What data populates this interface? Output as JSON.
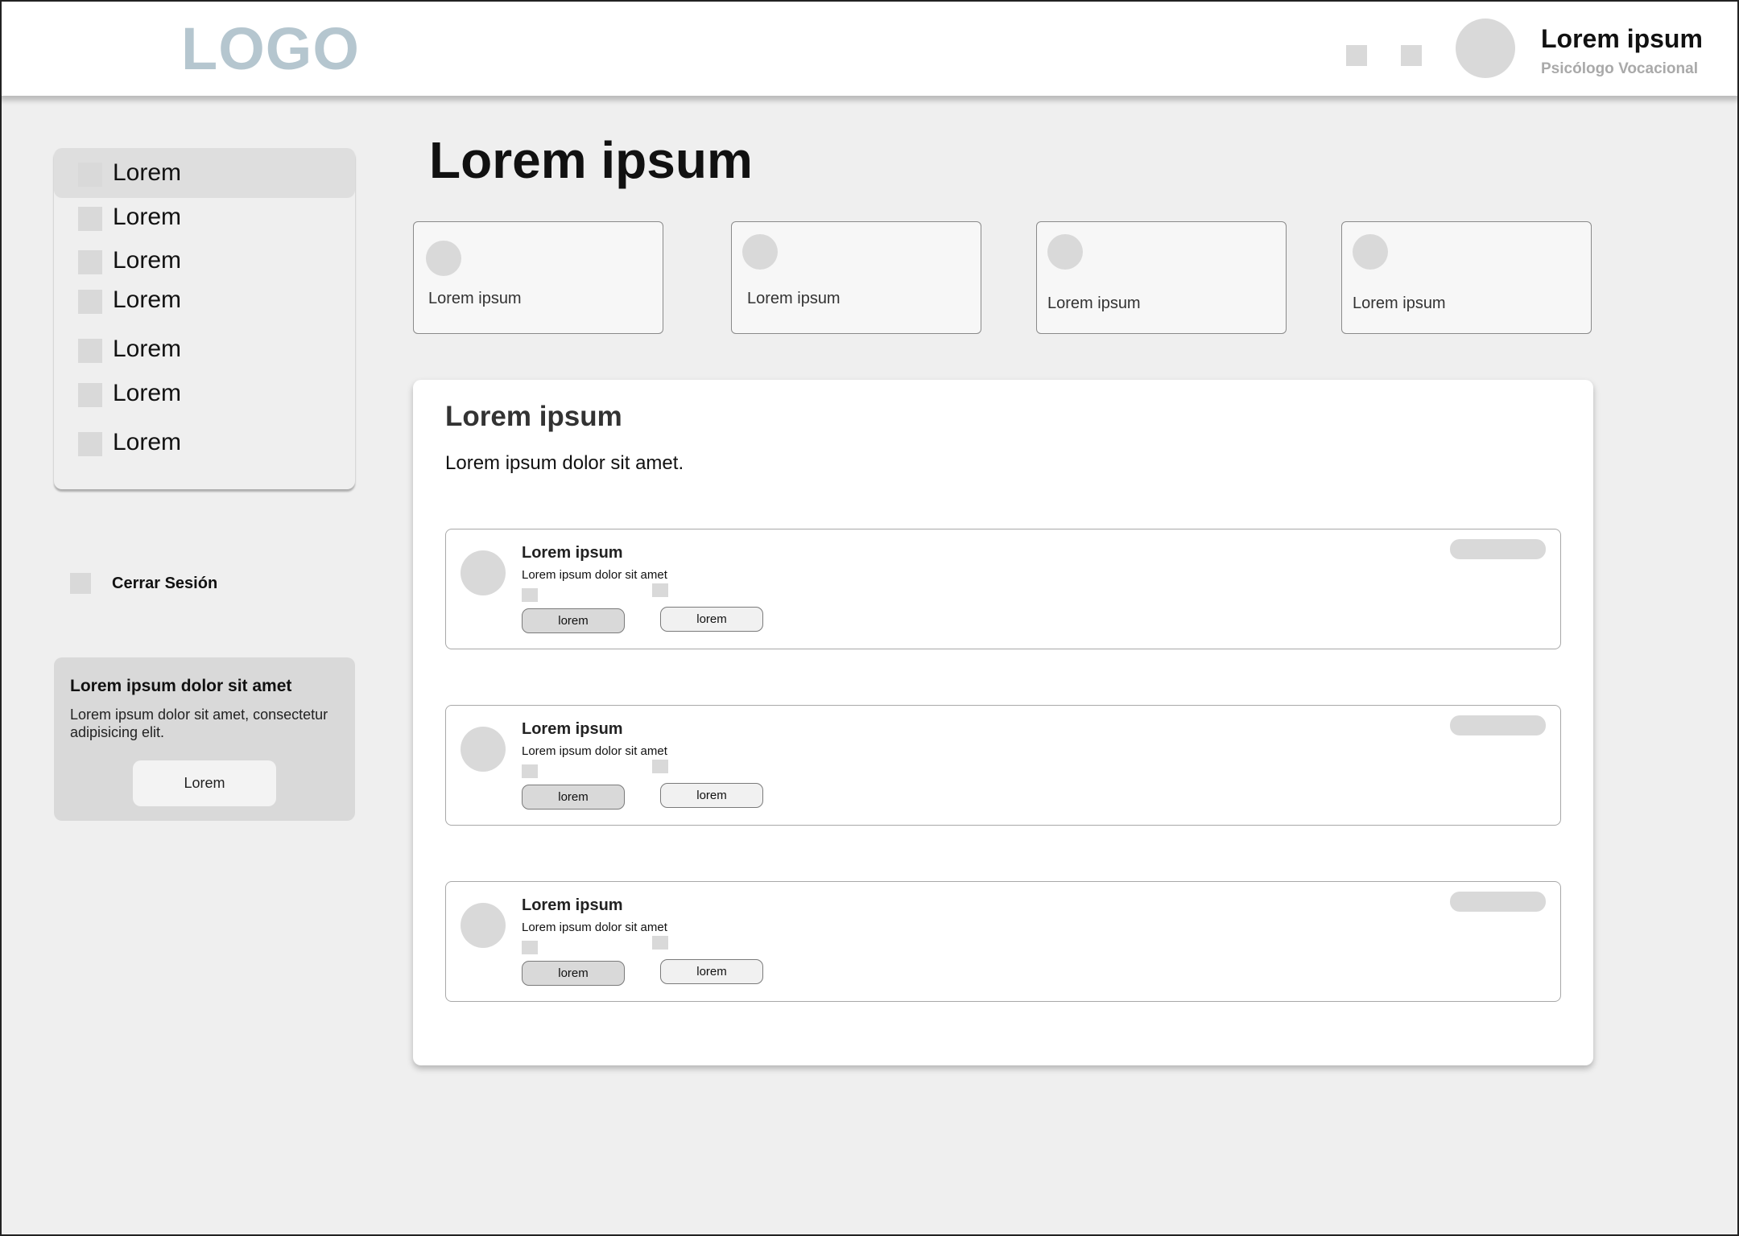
{
  "header": {
    "logo": "LOGO",
    "user_name": "Lorem ipsum",
    "user_role": "Psicólogo Vocacional"
  },
  "sidebar": {
    "items": [
      {
        "label": "Lorem"
      },
      {
        "label": "Lorem"
      },
      {
        "label": "Lorem"
      },
      {
        "label": "Lorem"
      },
      {
        "label": "Lorem"
      },
      {
        "label": "Lorem"
      },
      {
        "label": "Lorem"
      }
    ],
    "logout_label": "Cerrar Sesión",
    "promo": {
      "title": "Lorem ipsum dolor sit amet",
      "text": "Lorem ipsum dolor sit amet, consectetur adipisicing elit.",
      "button": "Lorem"
    }
  },
  "main": {
    "title": "Lorem ipsum",
    "stats": [
      {
        "label": "Lorem ipsum"
      },
      {
        "label": "Lorem ipsum"
      },
      {
        "label": "Lorem ipsum"
      },
      {
        "label": "Lorem ipsum"
      }
    ],
    "panel": {
      "title": "Lorem ipsum",
      "subtitle": "Lorem ipsum dolor sit amet.",
      "requests": [
        {
          "name": "Lorem ipsum",
          "desc": "Lorem ipsum dolor sit amet",
          "button1": "lorem",
          "button2": "lorem"
        },
        {
          "name": "Lorem ipsum",
          "desc": "Lorem ipsum dolor sit amet",
          "button1": "lorem",
          "button2": "lorem"
        },
        {
          "name": "Lorem ipsum",
          "desc": "Lorem ipsum dolor sit amet",
          "button1": "lorem",
          "button2": "lorem"
        }
      ]
    }
  }
}
